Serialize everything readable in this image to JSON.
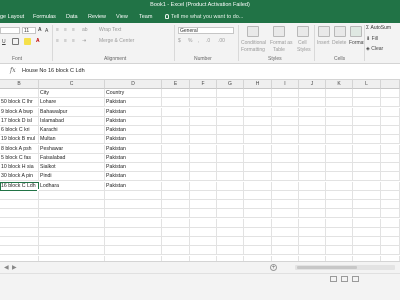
{
  "window": {
    "title": "Book1 - Excel (Product Activation Failed)"
  },
  "ribbon_tabs": [
    "ge Layout",
    "Formulas",
    "Data",
    "Review",
    "View",
    "Team"
  ],
  "tell_me": "Tell me what you want to do...",
  "ribbon": {
    "font_name": "",
    "font_size": "11",
    "wrap_text": "Wrap Text",
    "merge_center": "Merge & Center",
    "number_format": "General",
    "conditional_formatting": [
      "Conditional",
      "Formatting"
    ],
    "format_as_table": [
      "Format as",
      "Table"
    ],
    "cell_styles": [
      "Cell",
      "Styles"
    ],
    "insert": "Insert",
    "delete": "Delete",
    "format": "Format",
    "autosum": "AutoSum",
    "fill": "Fill",
    "clear": "Clear",
    "groups": {
      "font": "Font",
      "alignment": "Alignment",
      "number": "Number",
      "styles": "Styles",
      "cells": "Cells"
    }
  },
  "formula_bar": {
    "value": "House No 16 block C Ldh"
  },
  "columns": [
    "B",
    "C",
    "D",
    "E",
    "F",
    "G",
    "H",
    "I",
    "J",
    "K",
    "L"
  ],
  "headers": {
    "city": "City",
    "country": "Country"
  },
  "rows": [
    {
      "address": "50 block C lhr",
      "city": "Lohare",
      "country": "Pakistan"
    },
    {
      "address": "9 block A bwp",
      "city": "Bahawalpur",
      "country": "Pakistan"
    },
    {
      "address": "17 block D isl",
      "city": "Islamabad",
      "country": "Pakistan"
    },
    {
      "address": "6 block C kri",
      "city": "Karachi",
      "country": "Pakistan"
    },
    {
      "address": "19 block B mul",
      "city": "Multan",
      "country": "Pakistan"
    },
    {
      "address": "8 block A psh",
      "city": "Peshawar",
      "country": "Pakistan"
    },
    {
      "address": "5 block C fas",
      "city": "Faisalabad",
      "country": "Pakistan"
    },
    {
      "address": "10 block H sia",
      "city": "Sialkot",
      "country": "Pakistan"
    },
    {
      "address": "30 block A pin",
      "city": "Pindi",
      "country": "Pakistan"
    },
    {
      "address": "16 block C Ldh",
      "city": "Lodhara",
      "country": "Pakistan"
    }
  ],
  "selected_cell_text": "16 block C Ldh",
  "status": {
    "text": ""
  },
  "colors": {
    "accent": "#217346",
    "ribbon_bg": "#f3f3f3",
    "grid_line": "#e2e2e2"
  }
}
